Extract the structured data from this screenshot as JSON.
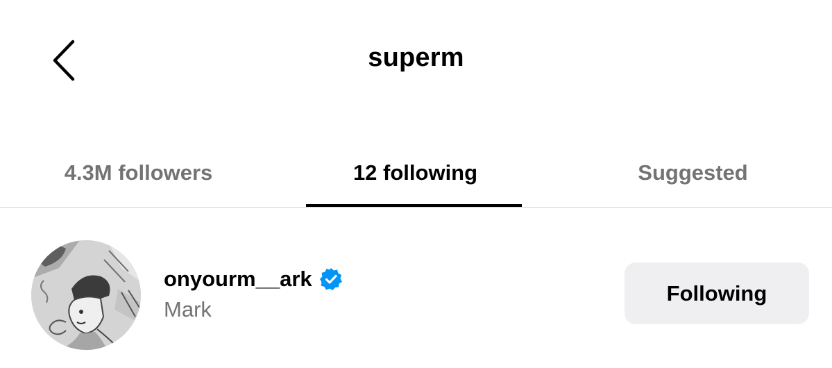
{
  "header": {
    "title": "superm",
    "back_icon": "chevron-left-icon"
  },
  "tabs": [
    {
      "label": "4.3M followers",
      "active": false
    },
    {
      "label": "12 following",
      "active": true
    },
    {
      "label": "Suggested",
      "active": false
    }
  ],
  "list": {
    "items": [
      {
        "username": "onyourm__ark",
        "full_name": "Mark",
        "verified": true,
        "verified_icon": "verified-badge-icon",
        "avatar_icon": "avatar-sketch-image",
        "action_label": "Following"
      }
    ]
  },
  "colors": {
    "text_primary": "#000000",
    "text_secondary": "#737373",
    "verified_blue": "#0095f6",
    "button_bg": "#efeff2",
    "divider": "#dbdbdb"
  }
}
